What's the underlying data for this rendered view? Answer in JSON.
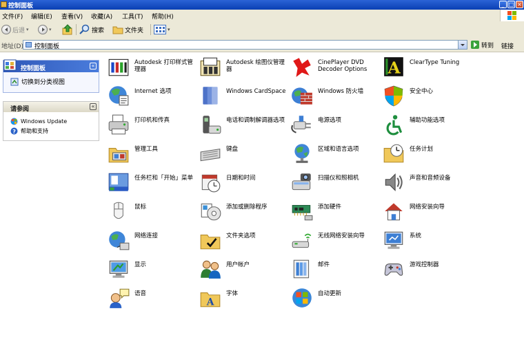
{
  "window": {
    "title": "控制面板"
  },
  "menu": [
    "文件(F)",
    "编辑(E)",
    "查看(V)",
    "收藏(A)",
    "工具(T)",
    "帮助(H)"
  ],
  "toolbar": {
    "back": "后退",
    "search": "搜索",
    "folders": "文件夹"
  },
  "address": {
    "label": "地址(D)",
    "value": "控制面板",
    "go": "转到",
    "links": "链接"
  },
  "sidebar": {
    "panel_title": "控制面板",
    "switch_view": "切换到分类视图",
    "see_also_title": "请参阅",
    "see_also": [
      "Windows Update",
      "帮助和支持"
    ]
  },
  "items": [
    {
      "label": "Autodesk 打印样式管理器",
      "icon": "autodesk-print-style-icon"
    },
    {
      "label": "Autodesk 绘图仪管理器",
      "icon": "autodesk-plotter-icon"
    },
    {
      "label": "CinePlayer DVD Decoder Options",
      "icon": "cineplayer-icon"
    },
    {
      "label": "ClearType Tuning",
      "icon": "cleartype-icon"
    },
    {
      "label": "Internet 选项",
      "icon": "internet-options-icon"
    },
    {
      "label": "Windows CardSpace",
      "icon": "cardspace-icon"
    },
    {
      "label": "Windows 防火墙",
      "icon": "firewall-icon"
    },
    {
      "label": "安全中心",
      "icon": "security-center-icon"
    },
    {
      "label": "打印机和传真",
      "icon": "printer-icon"
    },
    {
      "label": "电话和调制解调器选项",
      "icon": "phone-modem-icon"
    },
    {
      "label": "电源选项",
      "icon": "power-icon"
    },
    {
      "label": "辅助功能选项",
      "icon": "accessibility-icon"
    },
    {
      "label": "管理工具",
      "icon": "admin-tools-icon"
    },
    {
      "label": "键盘",
      "icon": "keyboard-icon"
    },
    {
      "label": "区域和语言选项",
      "icon": "region-language-icon"
    },
    {
      "label": "任务计划",
      "icon": "scheduled-tasks-icon"
    },
    {
      "label": "任务栏和「开始」菜单",
      "icon": "taskbar-icon"
    },
    {
      "label": "日期和时间",
      "icon": "date-time-icon"
    },
    {
      "label": "扫描仪和照相机",
      "icon": "scanner-camera-icon"
    },
    {
      "label": "声音和音频设备",
      "icon": "sound-icon"
    },
    {
      "label": "鼠标",
      "icon": "mouse-icon"
    },
    {
      "label": "添加或删除程序",
      "icon": "add-remove-programs-icon"
    },
    {
      "label": "添加硬件",
      "icon": "add-hardware-icon"
    },
    {
      "label": "网络安装向导",
      "icon": "network-setup-icon"
    },
    {
      "label": "网络连接",
      "icon": "network-connections-icon"
    },
    {
      "label": "文件夹选项",
      "icon": "folder-options-icon"
    },
    {
      "label": "无线网络安装向导",
      "icon": "wireless-setup-icon"
    },
    {
      "label": "系统",
      "icon": "system-icon"
    },
    {
      "label": "显示",
      "icon": "display-icon"
    },
    {
      "label": "用户帐户",
      "icon": "user-accounts-icon"
    },
    {
      "label": "邮件",
      "icon": "mail-icon"
    },
    {
      "label": "游戏控制器",
      "icon": "game-controllers-icon"
    },
    {
      "label": "语音",
      "icon": "speech-icon"
    },
    {
      "label": "字体",
      "icon": "fonts-icon"
    },
    {
      "label": "自动更新",
      "icon": "automatic-updates-icon"
    }
  ]
}
